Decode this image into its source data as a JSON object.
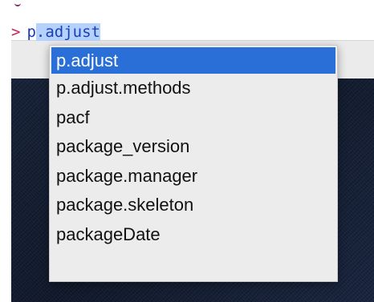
{
  "console": {
    "prompt": ">",
    "typed_prefix": "p",
    "typed_selected": ".adjust"
  },
  "autocomplete": {
    "items": [
      {
        "label": "p.adjust",
        "selected": true
      },
      {
        "label": "p.adjust.methods",
        "selected": false
      },
      {
        "label": "pacf",
        "selected": false
      },
      {
        "label": "package_version",
        "selected": false
      },
      {
        "label": "package.manager",
        "selected": false
      },
      {
        "label": "package.skeleton",
        "selected": false
      },
      {
        "label": "packageDate",
        "selected": false
      }
    ]
  },
  "colors": {
    "selection_highlight": "#2a6ed8",
    "prompt_caret": "#c8245a",
    "code_text": "#1a3fb4",
    "text_selection": "#b5d2ff"
  }
}
